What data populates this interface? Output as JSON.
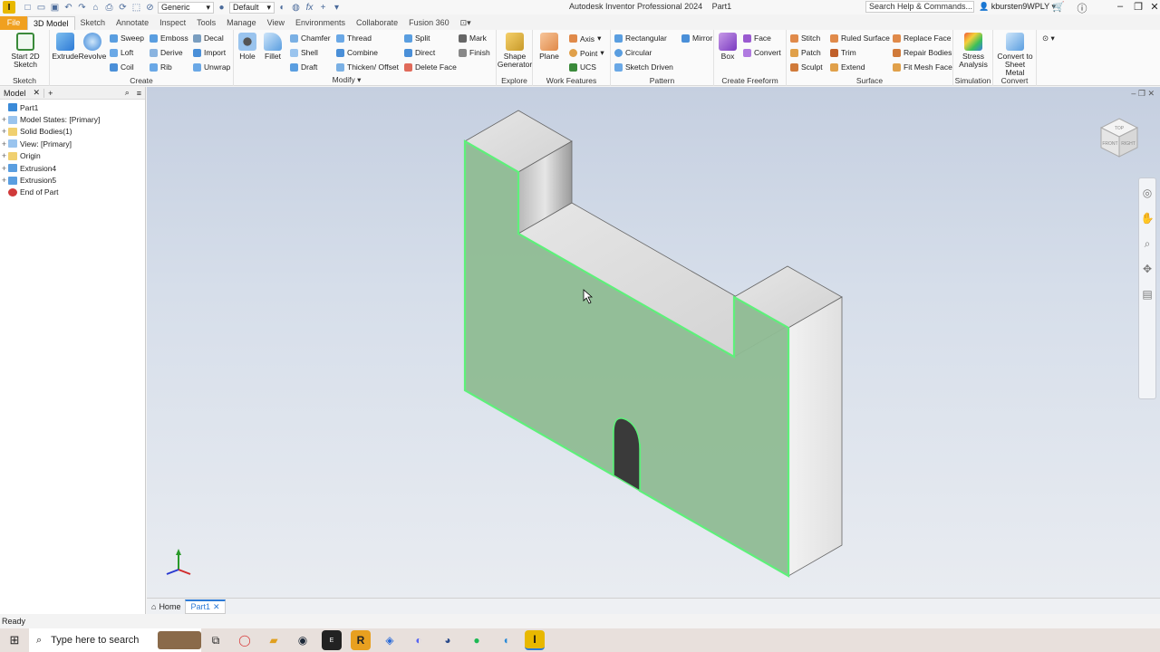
{
  "app": {
    "badge": "I",
    "title": "Autodesk Inventor Professional 2024",
    "document": "Part1",
    "help_search_placeholder": "Search Help & Commands...",
    "user": "kbursten9WPLY",
    "appearance_dropdown": "Generic",
    "material_dropdown": "Default"
  },
  "ribbon_tabs": [
    "File",
    "3D Model",
    "Sketch",
    "Annotate",
    "Inspect",
    "Tools",
    "Manage",
    "View",
    "Environments",
    "Collaborate",
    "Fusion 360"
  ],
  "ribbon": {
    "sketch": {
      "label": "Sketch",
      "start_sketch": "Start 2D Sketch"
    },
    "create": {
      "label": "Create",
      "extrude": "Extrude",
      "revolve": "Revolve",
      "sweep": "Sweep",
      "loft": "Loft",
      "coil": "Coil",
      "emboss": "Emboss",
      "derive": "Derive",
      "rib": "Rib",
      "decal": "Decal",
      "import": "Import",
      "unwrap": "Unwrap"
    },
    "modify": {
      "label": "Modify",
      "hole": "Hole",
      "fillet": "Fillet",
      "chamfer": "Chamfer",
      "shell": "Shell",
      "draft": "Draft",
      "thread": "Thread",
      "combine": "Combine",
      "thicken": "Thicken/ Offset",
      "split": "Split",
      "direct": "Direct",
      "delete_face": "Delete Face"
    },
    "explore": {
      "label": "Explore",
      "shape_generator": "Shape Generator",
      "mark": "Mark",
      "finish": "Finish"
    },
    "work_features": {
      "label": "Work Features",
      "plane": "Plane",
      "axis": "Axis",
      "point": "Point",
      "ucs": "UCS"
    },
    "pattern": {
      "label": "Pattern",
      "rectangular": "Rectangular",
      "circular": "Circular",
      "sketch_driven": "Sketch Driven",
      "mirror": "Mirror"
    },
    "freeform": {
      "label": "Create Freeform",
      "box": "Box",
      "face": "Face",
      "convert": "Convert"
    },
    "surface": {
      "label": "Surface",
      "stitch": "Stitch",
      "patch": "Patch",
      "sculpt": "Sculpt",
      "ruled_surface": "Ruled Surface",
      "trim": "Trim",
      "extend": "Extend",
      "replace_face": "Replace Face",
      "repair_bodies": "Repair Bodies",
      "fit_mesh_face": "Fit Mesh Face"
    },
    "simulation": {
      "label": "Simulation",
      "stress": "Stress Analysis"
    },
    "convert": {
      "label": "Convert",
      "sheet_metal": "Convert to Sheet Metal"
    }
  },
  "browser": {
    "tab": "Model",
    "items": [
      {
        "label": "Part1",
        "expand": ""
      },
      {
        "label": "Model States: [Primary]",
        "expand": "+"
      },
      {
        "label": "Solid Bodies(1)",
        "expand": "+"
      },
      {
        "label": "View: [Primary]",
        "expand": "+"
      },
      {
        "label": "Origin",
        "expand": "+"
      },
      {
        "label": "Extrusion4",
        "expand": "+"
      },
      {
        "label": "Extrusion5",
        "expand": "+"
      },
      {
        "label": "End of Part",
        "expand": ""
      }
    ]
  },
  "viewcube": {
    "front": "FRONT",
    "right": "RIGHT",
    "top": "TOP"
  },
  "doc_tabs": {
    "home": "Home",
    "part": "Part1"
  },
  "status": "Ready",
  "taskbar": {
    "search_placeholder": "Type here to search"
  },
  "colors": {
    "accent_blue": "#2d7ad6",
    "file_tab": "#f0a020",
    "selected_face": "#8fbc94",
    "highlight_edge": "#5ef07a"
  }
}
